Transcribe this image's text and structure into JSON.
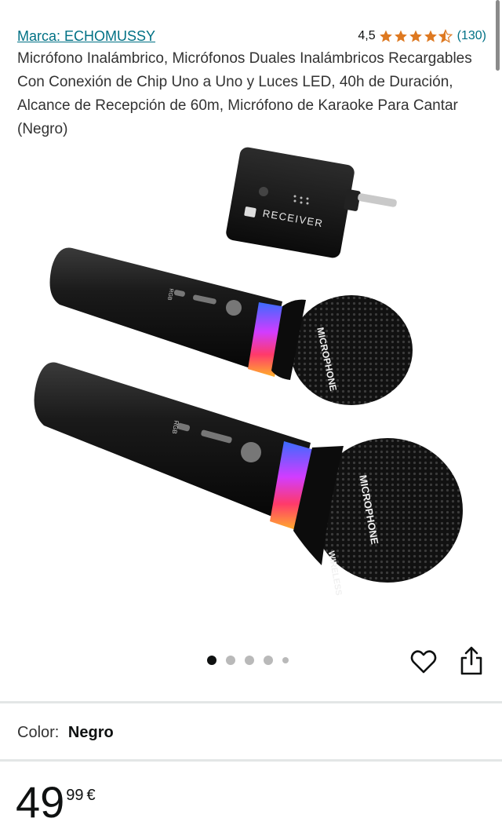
{
  "brand": {
    "label": "Marca: ECHOMUSSY"
  },
  "rating": {
    "value": "4,5",
    "stars": 4.5,
    "count": "(130)",
    "star_color": "#de7921"
  },
  "product": {
    "title": "Micrófono Inalámbrico, Micrófonos Duales Inalámbricos Recargables Con Conexión de Chip Uno a Uno y Luces LED, 40h de Duración, Alcance de Recepción de 60m, Micrófono de Karaoke Para Cantar (Negro)"
  },
  "image": {
    "receiver_label": "RECEIVER",
    "mic_label": "MICROPHONE",
    "mic_label2": "WIRELESS",
    "rgb_label": "RGB"
  },
  "carousel": {
    "total": 5,
    "active": 0
  },
  "variant": {
    "label": "Color:",
    "value": "Negro"
  },
  "price": {
    "whole": "49",
    "fraction": "99",
    "currency": "€"
  },
  "colors": {
    "link": "#007185",
    "text": "#0f1111"
  }
}
